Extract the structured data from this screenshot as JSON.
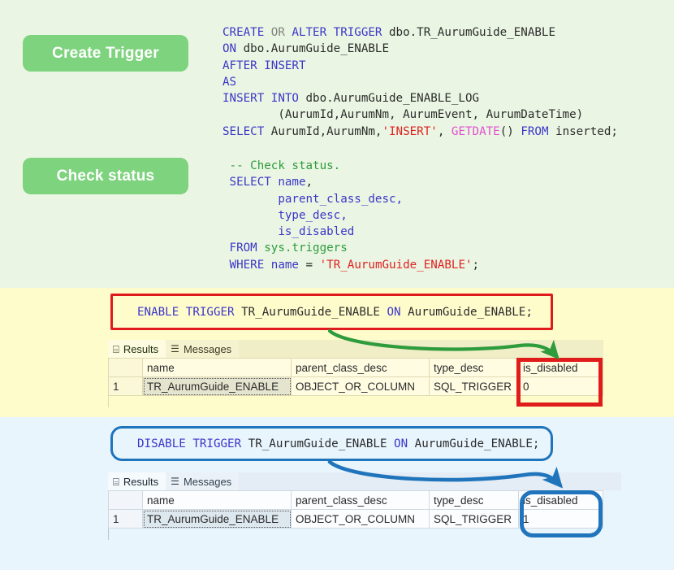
{
  "sections": {
    "create": {
      "button_label": "Create Trigger",
      "code_lines": [
        [
          {
            "t": "CREATE ",
            "c": "kw"
          },
          {
            "t": "OR ",
            "c": "kw2"
          },
          {
            "t": "ALTER TRIGGER ",
            "c": "kw"
          },
          {
            "t": "dbo.TR_AurumGuide_ENABLE",
            "c": "ident"
          }
        ],
        [
          {
            "t": "ON ",
            "c": "kw"
          },
          {
            "t": "dbo.AurumGuide_ENABLE",
            "c": "ident"
          }
        ],
        [
          {
            "t": "AFTER INSERT",
            "c": "kw"
          }
        ],
        [
          {
            "t": "AS",
            "c": "kw"
          }
        ],
        [
          {
            "t": "INSERT INTO ",
            "c": "kw"
          },
          {
            "t": "dbo.AurumGuide_ENABLE_LOG",
            "c": "ident"
          }
        ],
        [
          {
            "t": "        (AurumId,AurumNm, AurumEvent, AurumDateTime)",
            "c": "ident"
          }
        ],
        [
          {
            "t": "SELECT ",
            "c": "kw"
          },
          {
            "t": "AurumId,AurumNm,",
            "c": "ident"
          },
          {
            "t": "'INSERT'",
            "c": "str"
          },
          {
            "t": ", ",
            "c": "ident"
          },
          {
            "t": "GETDATE",
            "c": "fn"
          },
          {
            "t": "() ",
            "c": "ident"
          },
          {
            "t": "FROM ",
            "c": "kw"
          },
          {
            "t": "inserted;",
            "c": "ident"
          }
        ]
      ]
    },
    "check": {
      "button_label": "Check status",
      "code_lines": [
        [
          {
            "t": " -- Check status.",
            "c": "cmt"
          }
        ],
        [
          {
            "t": " SELECT ",
            "c": "kw"
          },
          {
            "t": "name",
            "c": "col"
          },
          {
            "t": ",",
            "c": "ident"
          }
        ],
        [
          {
            "t": "        parent_class_desc,",
            "c": "col"
          }
        ],
        [
          {
            "t": "        type_desc,",
            "c": "col"
          }
        ],
        [
          {
            "t": "        is_disabled",
            "c": "col"
          }
        ],
        [
          {
            "t": " FROM ",
            "c": "kw"
          },
          {
            "t": "sys.triggers",
            "c": "sys"
          }
        ],
        [
          {
            "t": " WHERE ",
            "c": "kw"
          },
          {
            "t": "name ",
            "c": "col"
          },
          {
            "t": "= ",
            "c": "ident"
          },
          {
            "t": "'TR_AurumGuide_ENABLE'",
            "c": "str"
          },
          {
            "t": ";",
            "c": "ident"
          }
        ]
      ]
    },
    "enable": {
      "statement": [
        {
          "t": "ENABLE TRIGGER ",
          "c": "kw"
        },
        {
          "t": "TR_AurumGuide_ENABLE ",
          "c": "ident"
        },
        {
          "t": "ON ",
          "c": "kw"
        },
        {
          "t": "AurumGuide_ENABLE;",
          "c": "ident"
        }
      ],
      "border_color": "#e01b1b",
      "arrow_color": "#2e9b3c",
      "results": {
        "tabs": [
          {
            "label": "Results",
            "icon": "grid-icon",
            "active": true
          },
          {
            "label": "Messages",
            "icon": "messages-icon",
            "active": false
          }
        ],
        "columns": [
          "",
          "name",
          "parent_class_desc",
          "type_desc",
          "is_disabled"
        ],
        "rows": [
          {
            "num": "1",
            "name": "TR_AurumGuide_ENABLE",
            "parent_class_desc": "OBJECT_OR_COLUMN",
            "type_desc": "SQL_TRIGGER",
            "is_disabled": "0"
          }
        ]
      }
    },
    "disable": {
      "statement": [
        {
          "t": "DISABLE TRIGGER ",
          "c": "kw"
        },
        {
          "t": "TR_AurumGuide_ENABLE ",
          "c": "ident"
        },
        {
          "t": "ON ",
          "c": "kw"
        },
        {
          "t": "AurumGuide_ENABLE;",
          "c": "ident"
        }
      ],
      "border_color": "#1f74bb",
      "arrow_color": "#1f74bb",
      "results": {
        "tabs": [
          {
            "label": "Results",
            "icon": "grid-icon",
            "active": true
          },
          {
            "label": "Messages",
            "icon": "messages-icon",
            "active": false
          }
        ],
        "columns": [
          "",
          "name",
          "parent_class_desc",
          "type_desc",
          "is_disabled"
        ],
        "rows": [
          {
            "num": "1",
            "name": "TR_AurumGuide_ENABLE",
            "parent_class_desc": "OBJECT_OR_COLUMN",
            "type_desc": "SQL_TRIGGER",
            "is_disabled": "1"
          }
        ]
      }
    }
  },
  "colors": {
    "panel_green": "#eaf6e3",
    "panel_yellow": "#fffccc",
    "panel_blue": "#e8f5fd",
    "button_green": "#7ed37e",
    "keyword_blue": "#3b36c8",
    "string_red": "#e02020",
    "comment_green": "#2e9b3c",
    "function_pink": "#e24fd0",
    "highlight_red": "#e01b1b",
    "highlight_blue": "#1f74bb"
  }
}
